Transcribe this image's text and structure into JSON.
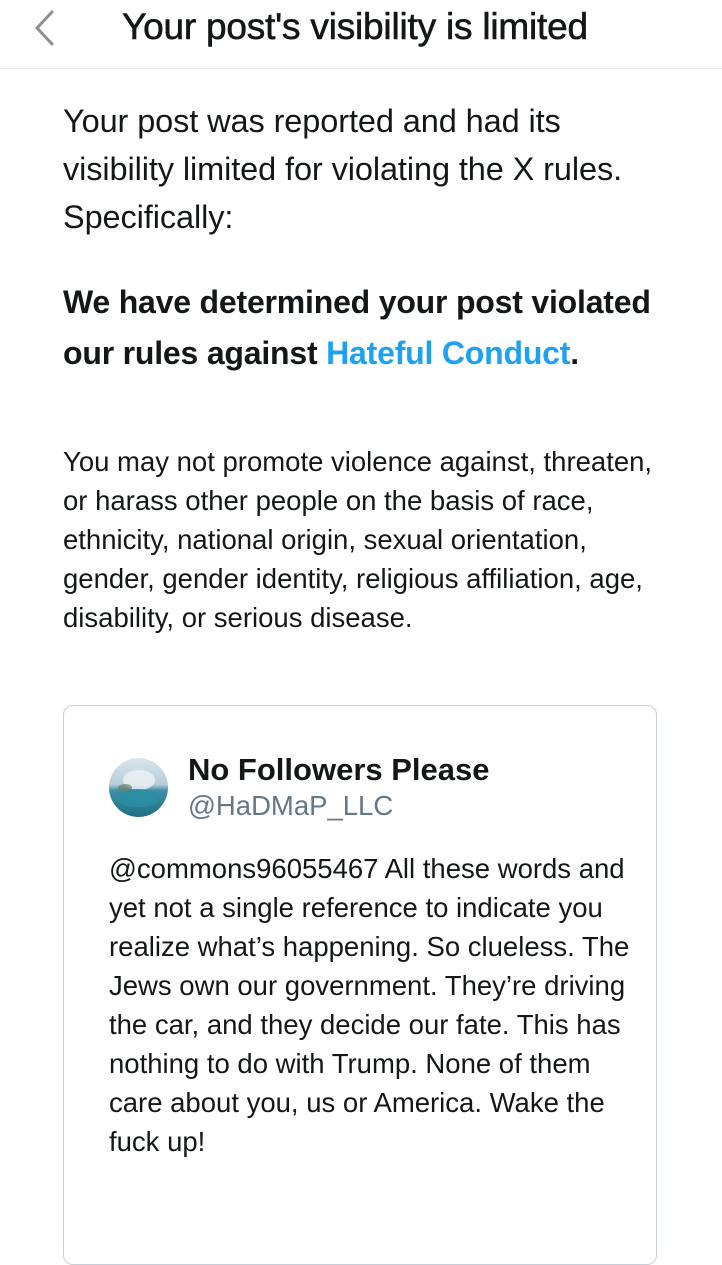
{
  "header": {
    "back_icon": "chevron-left-icon",
    "title": "Your post's visibility is limited"
  },
  "notice": {
    "intro": "Your post was reported and had its visibility limited for violating the X rules. Specifically:",
    "determination_prefix": "We have determined your post violated our rules against ",
    "policy_link": "Hateful Conduct",
    "determination_suffix": ".",
    "policy_description": "You may not promote violence against, threaten, or harass other people on the basis of race, ethnicity, national origin, sexual orientation, gender, gender identity, religious affiliation, age, disability, or serious disease."
  },
  "reported_post": {
    "display_name": "No Followers Please",
    "handle": "@HaDMaP_LLC",
    "text": "@commons96055467 All these words and yet not a single reference to indicate you realize what’s happening. So clueless. The Jews own our government. They’re driving the car, and they decide our fate. This has nothing to do with Trump. None of them care about you, us or America. Wake the fuck up!"
  },
  "colors": {
    "link": "#1da1f2",
    "text": "#14171a",
    "secondary_text": "#657786",
    "border": "#c5cfd8",
    "chevron": "#8e8e93"
  }
}
